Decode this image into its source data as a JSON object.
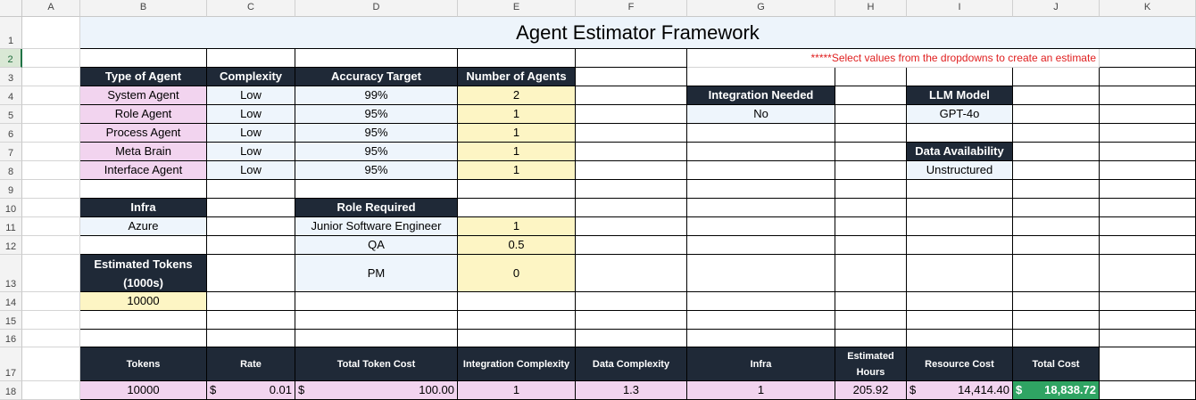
{
  "sheet": {
    "columns": [
      "A",
      "B",
      "C",
      "D",
      "E",
      "F",
      "G",
      "H",
      "I",
      "J",
      "K"
    ],
    "rows": [
      "1",
      "2",
      "3",
      "4",
      "5",
      "6",
      "7",
      "8",
      "9",
      "10",
      "11",
      "12",
      "13",
      "14",
      "15",
      "16",
      "17",
      "18"
    ],
    "selected_row": "2"
  },
  "title": "Agent Estimator Framework",
  "note": "*****Select values from the dropdowns to create an estimate",
  "agents_table": {
    "headers": {
      "type": "Type of Agent",
      "complexity": "Complexity",
      "accuracy": "Accuracy Target",
      "count": "Number of Agents"
    },
    "rows": [
      {
        "type": "System Agent",
        "complexity": "Low",
        "accuracy": "99%",
        "count": "2"
      },
      {
        "type": "Role Agent",
        "complexity": "Low",
        "accuracy": "95%",
        "count": "1"
      },
      {
        "type": "Process Agent",
        "complexity": "Low",
        "accuracy": "95%",
        "count": "1"
      },
      {
        "type": "Meta Brain",
        "complexity": "Low",
        "accuracy": "95%",
        "count": "1"
      },
      {
        "type": "Interface Agent",
        "complexity": "Low",
        "accuracy": "95%",
        "count": "1"
      }
    ]
  },
  "integration": {
    "header": "Integration Needed",
    "value": "No"
  },
  "llm": {
    "header": "LLM Model",
    "value": "GPT-4o"
  },
  "data_availability": {
    "header": "Data Availability",
    "value": "Unstructured"
  },
  "infra": {
    "header": "Infra",
    "value": "Azure"
  },
  "roles": {
    "header": "Role Required",
    "rows": [
      {
        "role": "Junior Software Engineer",
        "count": "1"
      },
      {
        "role": "QA",
        "count": "0.5"
      },
      {
        "role": "PM",
        "count": "0"
      }
    ]
  },
  "tokens_est": {
    "header": "Estimated Tokens (1000s)",
    "value": "10000"
  },
  "summary": {
    "headers": {
      "tokens": "Tokens",
      "rate": "Rate",
      "total_token_cost": "Total Token Cost",
      "integration_complexity": "Integration Complexity",
      "data_complexity": "Data Complexity",
      "infra": "Infra",
      "estimated_hours": "Estimated Hours",
      "resource_cost": "Resource Cost",
      "total_cost": "Total Cost"
    },
    "values": {
      "tokens": "10000",
      "rate_symbol": "$",
      "rate": "0.01",
      "total_token_cost_symbol": "$",
      "total_token_cost": "100.00",
      "integration_complexity": "1",
      "data_complexity": "1.3",
      "infra": "1",
      "estimated_hours": "205.92",
      "resource_cost_symbol": "$",
      "resource_cost": "14,414.40",
      "total_cost_symbol": "$",
      "total_cost": "18,838.72"
    }
  },
  "colors": {
    "header_dark": "#1f2937",
    "pink": "#f2d4ef",
    "light_blue": "#eef5fc",
    "yellow": "#fdf5c4",
    "total_green": "#2fa463",
    "note_red": "#e02020"
  }
}
